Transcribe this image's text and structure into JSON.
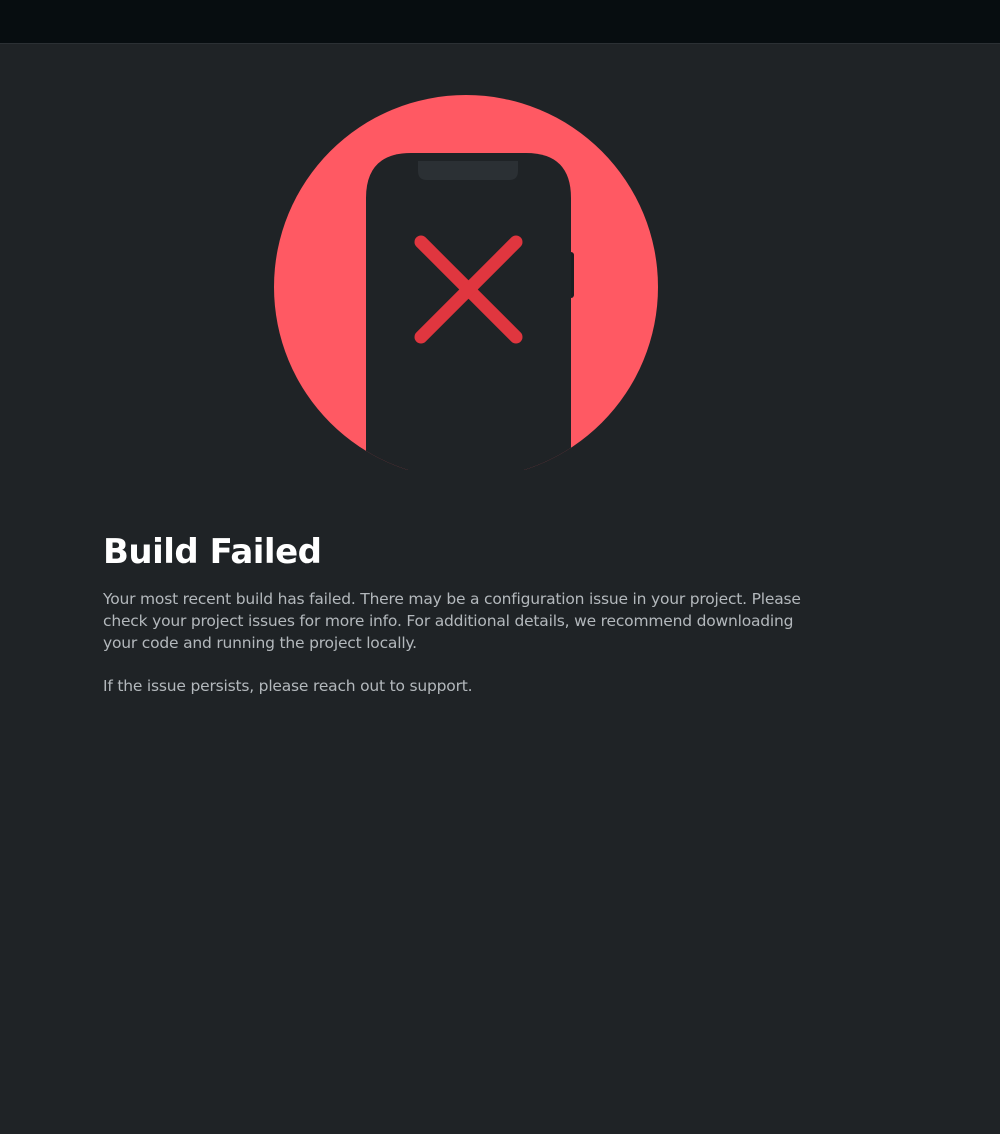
{
  "colors": {
    "background": "#1f2326",
    "top_bar": "#070d10",
    "circle": "#ff5963",
    "phone": "#1f2326",
    "phone_notch": "#2b3034",
    "cross": "#e0363f",
    "title": "#ffffff",
    "body_text": "#b3b8bc"
  },
  "illustration": {
    "icon": "phone-build-failed-icon"
  },
  "main": {
    "title": "Build Failed",
    "message": "Your most recent build has failed. There may be a configuration issue in your project. Please check your project issues for more info. For additional details, we recommend downloading your code and running the project locally.",
    "support_message": "If the issue persists, please reach out to support."
  }
}
